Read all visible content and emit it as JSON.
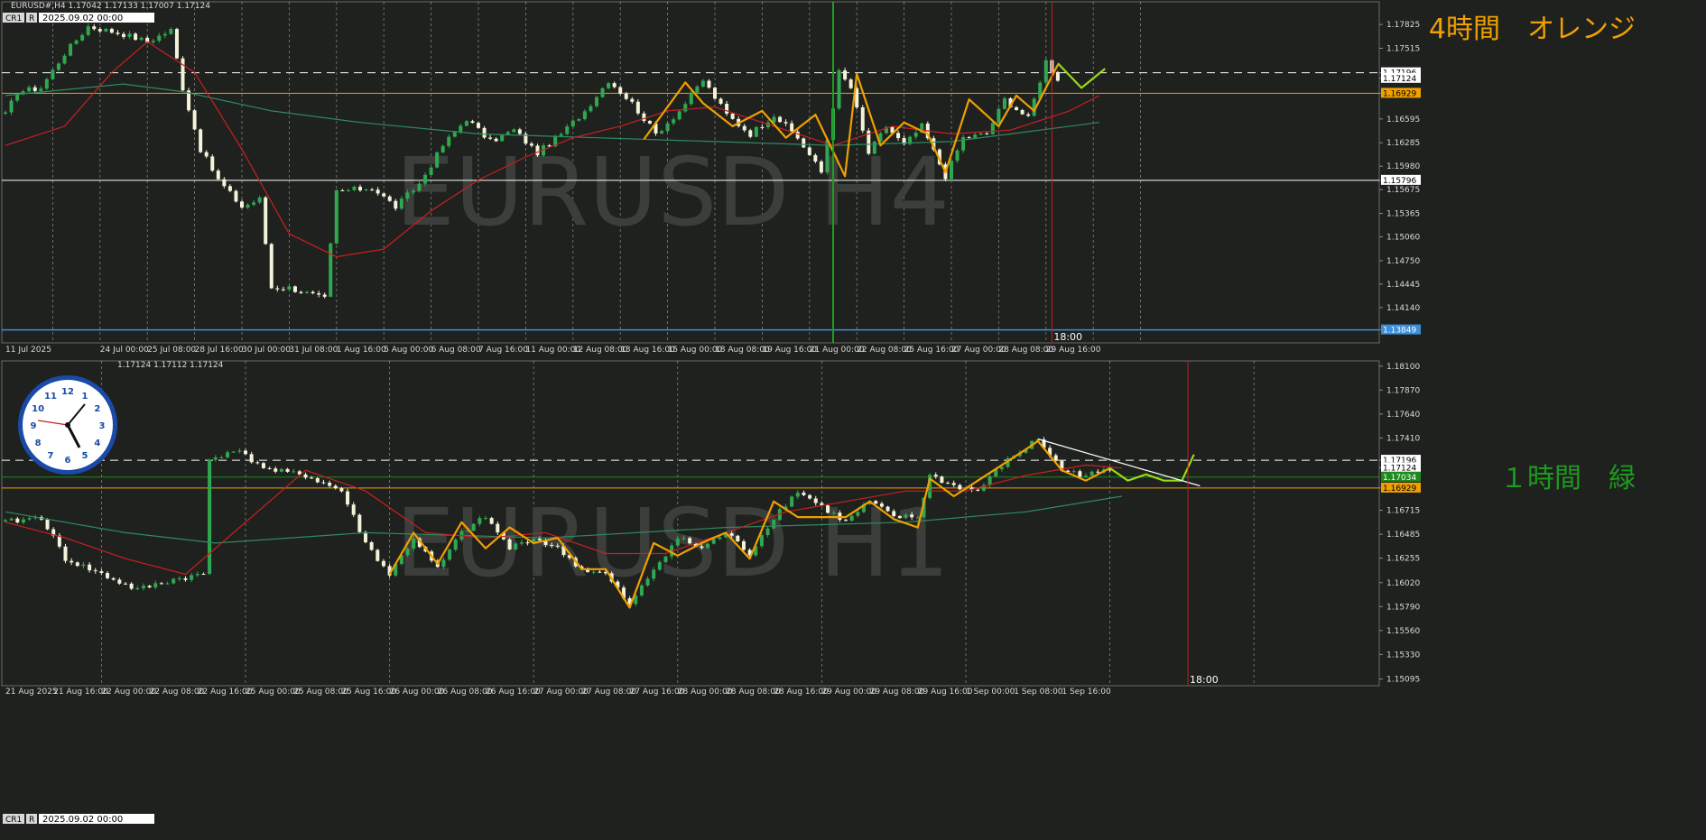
{
  "colors": {
    "background": "#1f211f",
    "grid": "#cfcfcf",
    "axis_text": "#d8d8d8",
    "bull_candle": "#2fa84f",
    "bear_candle": "#f4f2d8",
    "ma_fast": "#c82020",
    "ma_slow": "#2e8a5f",
    "zigzag_h4": "#f0a000",
    "zigzag_h1": "#f0a000",
    "projection": "#9ad81a",
    "level_orange": "#f0a000",
    "level_white": "#ffffff",
    "label_h4": "#f0a000",
    "label_h1": "#1e9a1e",
    "watermark": "#3c3e3c",
    "time_line": "#c02020",
    "vline_green": "#1ea01e",
    "h1_green_level": "#1e8a1e",
    "trendline": "#ffffff"
  },
  "panes": [
    {
      "header_info": "EURUSD#,H4  1.17042 1.17133 1.17007 1.17124",
      "tag_cr1": "CR1",
      "tag_r": "R",
      "date_box": "2025.09.02 00:00",
      "watermark": "EURUSD H4",
      "label": "4時間　オレンジ",
      "time_marker": "18:00",
      "ylim": [
        1.1368,
        1.1812
      ],
      "price_ticks": [
        "1.17825",
        "1.17515",
        "1.17196",
        "1.17124",
        "1.16929",
        "1.16595",
        "1.16285",
        "1.15980",
        "1.15796",
        "1.15675",
        "1.15365",
        "1.15060",
        "1.14750",
        "1.14445",
        "1.14140",
        "1.13849"
      ],
      "price_tick_values": [
        1.17825,
        1.17515,
        1.17196,
        1.17124,
        1.16929,
        1.16595,
        1.16285,
        1.1598,
        1.15796,
        1.15675,
        1.15365,
        1.1506,
        1.1475,
        1.14445,
        1.1414,
        1.13849
      ],
      "highlight_ticks": [
        {
          "text": "1.17196",
          "value": 1.17196,
          "style": "white"
        },
        {
          "text": "1.17124",
          "value": 1.17124,
          "style": "white"
        },
        {
          "text": "1.16929",
          "value": 1.16929,
          "style": "orange"
        },
        {
          "text": "1.15796",
          "value": 1.15796,
          "style": "white"
        },
        {
          "text": "1.13849",
          "value": 1.13849,
          "style": "blue"
        }
      ],
      "time_labels": [
        "11 Jul 2025",
        "24 Jul 00:00",
        "25 Jul 08:00",
        "28 Jul 16:00",
        "30 Jul 00:00",
        "31 Jul 08:00",
        "1 Aug 16:00",
        "5 Aug 00:00",
        "6 Aug 08:00",
        "7 Aug 16:00",
        "11 Aug 00:00",
        "12 Aug 08:00",
        "13 Aug 16:00",
        "15 Aug 00:00",
        "18 Aug 08:00",
        "19 Aug 16:00",
        "21 Aug 00:00",
        "22 Aug 08:00",
        "25 Aug 16:00",
        "27 Aug 00:00",
        "28 Aug 08:00",
        "29 Aug 16:00"
      ],
      "time_label_index": [
        0,
        16,
        24,
        32,
        40,
        48,
        56,
        64,
        72,
        80,
        88,
        96,
        104,
        112,
        120,
        128,
        136,
        144,
        152,
        160,
        168,
        176
      ],
      "grid_index": [
        8,
        16,
        24,
        32,
        40,
        48,
        56,
        64,
        72,
        80,
        88,
        96,
        104,
        112,
        120,
        128,
        136,
        144,
        152,
        160,
        168,
        176,
        184,
        192
      ],
      "levels": [
        {
          "price": 1.17196,
          "style": "dashed-white"
        },
        {
          "price": 1.16929,
          "style": "orange"
        },
        {
          "price": 1.15796,
          "style": "white"
        },
        {
          "price": 1.13849,
          "style": "blue"
        }
      ],
      "vline_green_index": 140,
      "time_line_index": 177
    },
    {
      "header_info": "1.17124 1.17112 1.17124",
      "tag_cr1": "CR1",
      "tag_r": "R",
      "date_box": "2025.09.02 00:00",
      "watermark": "EURUSD H1",
      "label": "１時間　緑",
      "time_marker": "18:00",
      "ylim": [
        1.1503,
        1.1815
      ],
      "price_ticks": [
        "1.18100",
        "1.17870",
        "1.17640",
        "1.17410",
        "1.17196",
        "1.17124",
        "1.16929",
        "1.16715",
        "1.16485",
        "1.16255",
        "1.16020",
        "1.15790",
        "1.15560",
        "1.15330",
        "1.15095"
      ],
      "price_tick_values": [
        1.181,
        1.1787,
        1.1764,
        1.1741,
        1.17196,
        1.17124,
        1.16929,
        1.16715,
        1.16485,
        1.16255,
        1.1602,
        1.1579,
        1.1556,
        1.1533,
        1.15095
      ],
      "highlight_ticks": [
        {
          "text": "1.17196",
          "value": 1.17196,
          "style": "white"
        },
        {
          "text": "1.17124",
          "value": 1.17124,
          "style": "white"
        },
        {
          "text": "1.17034",
          "value": 1.17034,
          "style": "green"
        },
        {
          "text": "1.16929",
          "value": 1.16929,
          "style": "orange"
        }
      ],
      "time_labels": [
        "21 Aug 2025",
        "21 Aug 16:00",
        "22 Aug 00:00",
        "22 Aug 08:00",
        "22 Aug 16:00",
        "25 Aug 00:00",
        "25 Aug 08:00",
        "25 Aug 16:00",
        "26 Aug 00:00",
        "26 Aug 08:00",
        "26 Aug 16:00",
        "27 Aug 00:00",
        "27 Aug 08:00",
        "27 Aug 16:00",
        "28 Aug 00:00",
        "28 Aug 08:00",
        "28 Aug 16:00",
        "29 Aug 00:00",
        "29 Aug 08:00",
        "29 Aug 16:00",
        "1 Sep 00:00",
        "1 Sep 08:00",
        "1 Sep 16:00"
      ],
      "time_label_index": [
        0,
        8,
        16,
        24,
        32,
        40,
        48,
        56,
        64,
        72,
        80,
        88,
        96,
        104,
        112,
        120,
        128,
        136,
        144,
        152,
        160,
        168,
        176
      ],
      "grid_index": [
        16,
        40,
        64,
        88,
        112,
        136,
        160,
        184,
        208
      ],
      "levels": [
        {
          "price": 1.17196,
          "style": "dashed-white"
        },
        {
          "price": 1.17034,
          "style": "green"
        },
        {
          "price": 1.16929,
          "style": "orange"
        }
      ],
      "time_line_index": 197
    }
  ],
  "chart_data": [
    {
      "type": "candlestick",
      "title": "EURUSD H4",
      "ylim": [
        1.1368,
        1.1812
      ],
      "key_points": [
        {
          "i": 0,
          "p": 1.1665
        },
        {
          "i": 2,
          "p": 1.1695
        },
        {
          "i": 6,
          "p": 1.17
        },
        {
          "i": 10,
          "p": 1.1745
        },
        {
          "i": 14,
          "p": 1.178
        },
        {
          "i": 20,
          "p": 1.177
        },
        {
          "i": 24,
          "p": 1.176
        },
        {
          "i": 28,
          "p": 1.1775
        },
        {
          "i": 30,
          "p": 1.17
        },
        {
          "i": 33,
          "p": 1.162
        },
        {
          "i": 36,
          "p": 1.158
        },
        {
          "i": 40,
          "p": 1.1545
        },
        {
          "i": 43,
          "p": 1.1555
        },
        {
          "i": 45,
          "p": 1.144
        },
        {
          "i": 48,
          "p": 1.144
        },
        {
          "i": 52,
          "p": 1.143
        },
        {
          "i": 54,
          "p": 1.1425
        },
        {
          "i": 56,
          "p": 1.1565
        },
        {
          "i": 62,
          "p": 1.157
        },
        {
          "i": 66,
          "p": 1.1545
        },
        {
          "i": 70,
          "p": 1.1575
        },
        {
          "i": 74,
          "p": 1.1625
        },
        {
          "i": 78,
          "p": 1.166
        },
        {
          "i": 82,
          "p": 1.163
        },
        {
          "i": 86,
          "p": 1.1645
        },
        {
          "i": 90,
          "p": 1.1615
        },
        {
          "i": 94,
          "p": 1.164
        },
        {
          "i": 98,
          "p": 1.167
        },
        {
          "i": 102,
          "p": 1.171
        },
        {
          "i": 106,
          "p": 1.168
        },
        {
          "i": 110,
          "p": 1.164
        },
        {
          "i": 114,
          "p": 1.167
        },
        {
          "i": 118,
          "p": 1.171
        },
        {
          "i": 122,
          "p": 1.1665
        },
        {
          "i": 126,
          "p": 1.164
        },
        {
          "i": 130,
          "p": 1.1665
        },
        {
          "i": 134,
          "p": 1.1635
        },
        {
          "i": 138,
          "p": 1.159
        },
        {
          "i": 141,
          "p": 1.172
        },
        {
          "i": 143,
          "p": 1.17
        },
        {
          "i": 146,
          "p": 1.1615
        },
        {
          "i": 149,
          "p": 1.165
        },
        {
          "i": 152,
          "p": 1.1625
        },
        {
          "i": 155,
          "p": 1.165
        },
        {
          "i": 159,
          "p": 1.1585
        },
        {
          "i": 162,
          "p": 1.1635
        },
        {
          "i": 166,
          "p": 1.164
        },
        {
          "i": 169,
          "p": 1.1685
        },
        {
          "i": 173,
          "p": 1.166
        },
        {
          "i": 176,
          "p": 1.1735
        },
        {
          "i": 178,
          "p": 1.1712
        }
      ],
      "ma_fast": [
        [
          0,
          1.1625
        ],
        [
          10,
          1.165
        ],
        [
          18,
          1.172
        ],
        [
          24,
          1.176
        ],
        [
          32,
          1.172
        ],
        [
          40,
          1.162
        ],
        [
          48,
          1.151
        ],
        [
          56,
          1.148
        ],
        [
          64,
          1.149
        ],
        [
          72,
          1.154
        ],
        [
          80,
          1.158
        ],
        [
          88,
          1.161
        ],
        [
          96,
          1.1635
        ],
        [
          104,
          1.165
        ],
        [
          112,
          1.167
        ],
        [
          120,
          1.1675
        ],
        [
          130,
          1.165
        ],
        [
          140,
          1.1625
        ],
        [
          150,
          1.165
        ],
        [
          160,
          1.164
        ],
        [
          170,
          1.1645
        ],
        [
          180,
          1.167
        ],
        [
          185,
          1.169
        ]
      ],
      "ma_slow": [
        [
          0,
          1.169
        ],
        [
          20,
          1.1705
        ],
        [
          30,
          1.1695
        ],
        [
          45,
          1.167
        ],
        [
          60,
          1.1655
        ],
        [
          80,
          1.164
        ],
        [
          100,
          1.1635
        ],
        [
          120,
          1.163
        ],
        [
          140,
          1.1625
        ],
        [
          160,
          1.163
        ],
        [
          175,
          1.1645
        ],
        [
          185,
          1.1655
        ]
      ],
      "zigzag": [
        [
          108,
          1.1633
        ],
        [
          115,
          1.1707
        ],
        [
          118,
          1.168
        ],
        [
          123,
          1.165
        ],
        [
          128,
          1.167
        ],
        [
          132,
          1.1635
        ],
        [
          137,
          1.1665
        ],
        [
          142,
          1.1585
        ],
        [
          144,
          1.1718
        ],
        [
          148,
          1.1625
        ],
        [
          152,
          1.1655
        ],
        [
          156,
          1.164
        ],
        [
          159,
          1.159
        ],
        [
          163,
          1.1685
        ],
        [
          168,
          1.165
        ],
        [
          171,
          1.169
        ],
        [
          174,
          1.167
        ],
        [
          178,
          1.173
        ]
      ],
      "projection": [
        [
          178,
          1.1732
        ],
        [
          182,
          1.17
        ],
        [
          186,
          1.1725
        ]
      ]
    },
    {
      "type": "candlestick",
      "title": "EURUSD H1",
      "ylim": [
        1.1503,
        1.1815
      ],
      "key_points": [
        {
          "i": 0,
          "p": 1.166
        },
        {
          "i": 6,
          "p": 1.1665
        },
        {
          "i": 10,
          "p": 1.1625
        },
        {
          "i": 16,
          "p": 1.161
        },
        {
          "i": 22,
          "p": 1.1595
        },
        {
          "i": 28,
          "p": 1.1605
        },
        {
          "i": 33,
          "p": 1.161
        },
        {
          "i": 34,
          "p": 1.172
        },
        {
          "i": 38,
          "p": 1.173
        },
        {
          "i": 44,
          "p": 1.171
        },
        {
          "i": 50,
          "p": 1.1705
        },
        {
          "i": 56,
          "p": 1.169
        },
        {
          "i": 60,
          "p": 1.164
        },
        {
          "i": 64,
          "p": 1.161
        },
        {
          "i": 68,
          "p": 1.1645
        },
        {
          "i": 72,
          "p": 1.1615
        },
        {
          "i": 76,
          "p": 1.165
        },
        {
          "i": 80,
          "p": 1.1665
        },
        {
          "i": 84,
          "p": 1.1635
        },
        {
          "i": 88,
          "p": 1.1645
        },
        {
          "i": 92,
          "p": 1.1635
        },
        {
          "i": 96,
          "p": 1.1615
        },
        {
          "i": 100,
          "p": 1.161
        },
        {
          "i": 104,
          "p": 1.158
        },
        {
          "i": 108,
          "p": 1.1615
        },
        {
          "i": 112,
          "p": 1.1645
        },
        {
          "i": 116,
          "p": 1.1635
        },
        {
          "i": 120,
          "p": 1.165
        },
        {
          "i": 124,
          "p": 1.163
        },
        {
          "i": 128,
          "p": 1.1665
        },
        {
          "i": 132,
          "p": 1.169
        },
        {
          "i": 136,
          "p": 1.1675
        },
        {
          "i": 140,
          "p": 1.166
        },
        {
          "i": 144,
          "p": 1.168
        },
        {
          "i": 148,
          "p": 1.1665
        },
        {
          "i": 152,
          "p": 1.1665
        },
        {
          "i": 154,
          "p": 1.1705
        },
        {
          "i": 158,
          "p": 1.1695
        },
        {
          "i": 162,
          "p": 1.169
        },
        {
          "i": 166,
          "p": 1.1715
        },
        {
          "i": 172,
          "p": 1.174
        },
        {
          "i": 176,
          "p": 1.171
        },
        {
          "i": 180,
          "p": 1.1705
        },
        {
          "i": 184,
          "p": 1.171
        }
      ],
      "ma_fast": [
        [
          0,
          1.166
        ],
        [
          10,
          1.1645
        ],
        [
          20,
          1.1625
        ],
        [
          30,
          1.161
        ],
        [
          40,
          1.166
        ],
        [
          50,
          1.171
        ],
        [
          60,
          1.169
        ],
        [
          70,
          1.165
        ],
        [
          80,
          1.1645
        ],
        [
          90,
          1.165
        ],
        [
          100,
          1.163
        ],
        [
          110,
          1.163
        ],
        [
          120,
          1.165
        ],
        [
          130,
          1.167
        ],
        [
          140,
          1.168
        ],
        [
          150,
          1.169
        ],
        [
          160,
          1.169
        ],
        [
          170,
          1.1705
        ],
        [
          180,
          1.1715
        ],
        [
          186,
          1.1712
        ]
      ],
      "ma_slow": [
        [
          0,
          1.167
        ],
        [
          20,
          1.165
        ],
        [
          35,
          1.164
        ],
        [
          60,
          1.165
        ],
        [
          90,
          1.1645
        ],
        [
          120,
          1.1655
        ],
        [
          150,
          1.166
        ],
        [
          170,
          1.167
        ],
        [
          186,
          1.1685
        ]
      ],
      "zigzag": [
        [
          64,
          1.161
        ],
        [
          68,
          1.165
        ],
        [
          72,
          1.162
        ],
        [
          76,
          1.166
        ],
        [
          80,
          1.1635
        ],
        [
          84,
          1.1655
        ],
        [
          88,
          1.164
        ],
        [
          92,
          1.1645
        ],
        [
          96,
          1.1615
        ],
        [
          100,
          1.1615
        ],
        [
          104,
          1.1578
        ],
        [
          108,
          1.164
        ],
        [
          112,
          1.1628
        ],
        [
          116,
          1.164
        ],
        [
          120,
          1.165
        ],
        [
          124,
          1.1625
        ],
        [
          128,
          1.168
        ],
        [
          132,
          1.1665
        ],
        [
          136,
          1.1665
        ],
        [
          140,
          1.1665
        ],
        [
          144,
          1.168
        ],
        [
          148,
          1.1663
        ],
        [
          152,
          1.1655
        ],
        [
          154,
          1.1702
        ],
        [
          158,
          1.1685
        ],
        [
          162,
          1.17
        ],
        [
          166,
          1.1715
        ],
        [
          170,
          1.173
        ],
        [
          172,
          1.1738
        ],
        [
          176,
          1.171
        ],
        [
          180,
          1.17
        ],
        [
          184,
          1.1712
        ]
      ],
      "projection": [
        [
          184,
          1.1712
        ],
        [
          187,
          1.17
        ],
        [
          190,
          1.1706
        ],
        [
          193,
          1.17
        ],
        [
          196,
          1.17
        ],
        [
          198,
          1.1725
        ]
      ],
      "trendline": [
        [
          172,
          1.174
        ],
        [
          199,
          1.1695
        ]
      ]
    }
  ]
}
